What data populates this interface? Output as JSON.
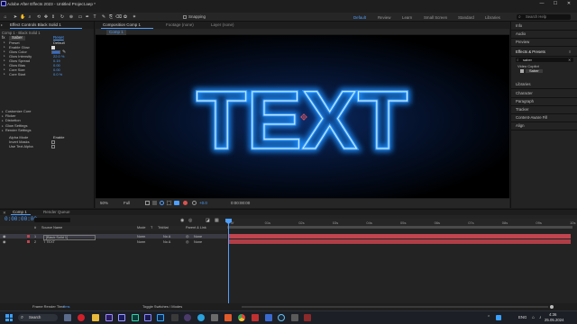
{
  "window": {
    "title": "Adobe After Effects 2023 - Untitled Project.aep *",
    "minimize": "—",
    "maximize": "☐",
    "close": "✕"
  },
  "menu": [
    "File",
    "Edit",
    "Composition",
    "Layer",
    "Effect",
    "Animation",
    "View",
    "Window",
    "Help"
  ],
  "toolbar": {
    "snapping_label": "Snapping",
    "workspaces": [
      "Default",
      "Review",
      "Learn",
      "Small Screen",
      "Standard",
      "Libraries"
    ],
    "search_placeholder": "Search Help"
  },
  "effect_controls": {
    "tab_label": "Effect Controls Black Solid 1",
    "subtitle": "Comp 1 · Black Solid 1",
    "effect_name": "Saber",
    "rows": [
      {
        "label": "Preset",
        "value": "Default"
      },
      {
        "label": "Enable Glow",
        "value": ""
      },
      {
        "label": "Glow Color",
        "value": ""
      },
      {
        "label": "Glow Intensity",
        "value": "22.0 %"
      },
      {
        "label": "Glow Spread",
        "value": "0.19"
      },
      {
        "label": "Glow Bias",
        "value": "0.00"
      },
      {
        "label": "Core Size",
        "value": "0.00"
      },
      {
        "label": "Core Start",
        "value": "0.0 %"
      }
    ],
    "groups": [
      "Customize Core",
      "Flicker",
      "Distortion",
      "Glow Settings",
      "Render Settings"
    ],
    "render_rows": [
      {
        "label": "Alpha Mode",
        "value": "Enable"
      },
      {
        "label": "Invert Masks",
        "value": ""
      },
      {
        "label": "Use Text Alpha",
        "value": ""
      }
    ]
  },
  "composition": {
    "tabs": [
      "Composition Comp 1",
      "Footage (none)",
      "Layer (none)"
    ],
    "subtab": "Comp 1",
    "neon_text": "TEXT",
    "zoom": "50%",
    "resolution": "Full",
    "exposure": "+0.0",
    "timecode": "0:00:00:00"
  },
  "right_panel": {
    "items": [
      "Info",
      "Audio",
      "Preview",
      "Effects & Presets",
      "Libraries",
      "Character",
      "Paragraph",
      "Tracker",
      "Content-Aware Fill",
      "Align"
    ],
    "effects_search": "saber",
    "effects_group": "Video Copilot",
    "effects_result": "Saber"
  },
  "timeline": {
    "tabs": [
      "Comp 1",
      "Render Queue"
    ],
    "timecode": "0:00:00:00",
    "columns": [
      "#",
      "Source Name",
      "Mode",
      "T",
      "TrkMat",
      "Parent & Link"
    ],
    "layers": [
      {
        "index": "1",
        "name": "[Black Solid 1]",
        "mode": "Norm",
        "trkmat": "No A",
        "parent": "None"
      },
      {
        "index": "2",
        "name": "T TEXT",
        "mode": "Norm",
        "trkmat": "No A",
        "parent": "None"
      }
    ],
    "ruler": [
      "0f",
      "01s",
      "02s",
      "03s",
      "04s",
      "05s",
      "06s",
      "07s",
      "08s",
      "09s",
      "10s"
    ],
    "footer_left": "Frame Render Time",
    "footer_left_value": "0ms",
    "footer_center": "Toggle Switches / Modes"
  },
  "taskbar": {
    "search": "Search",
    "lang": "ENG",
    "time": "4:36",
    "date": "25.05.2024"
  },
  "colors": {
    "accent": "#4e9fff",
    "neon": "#1f8fff",
    "layer_bar": "#c0454f"
  }
}
